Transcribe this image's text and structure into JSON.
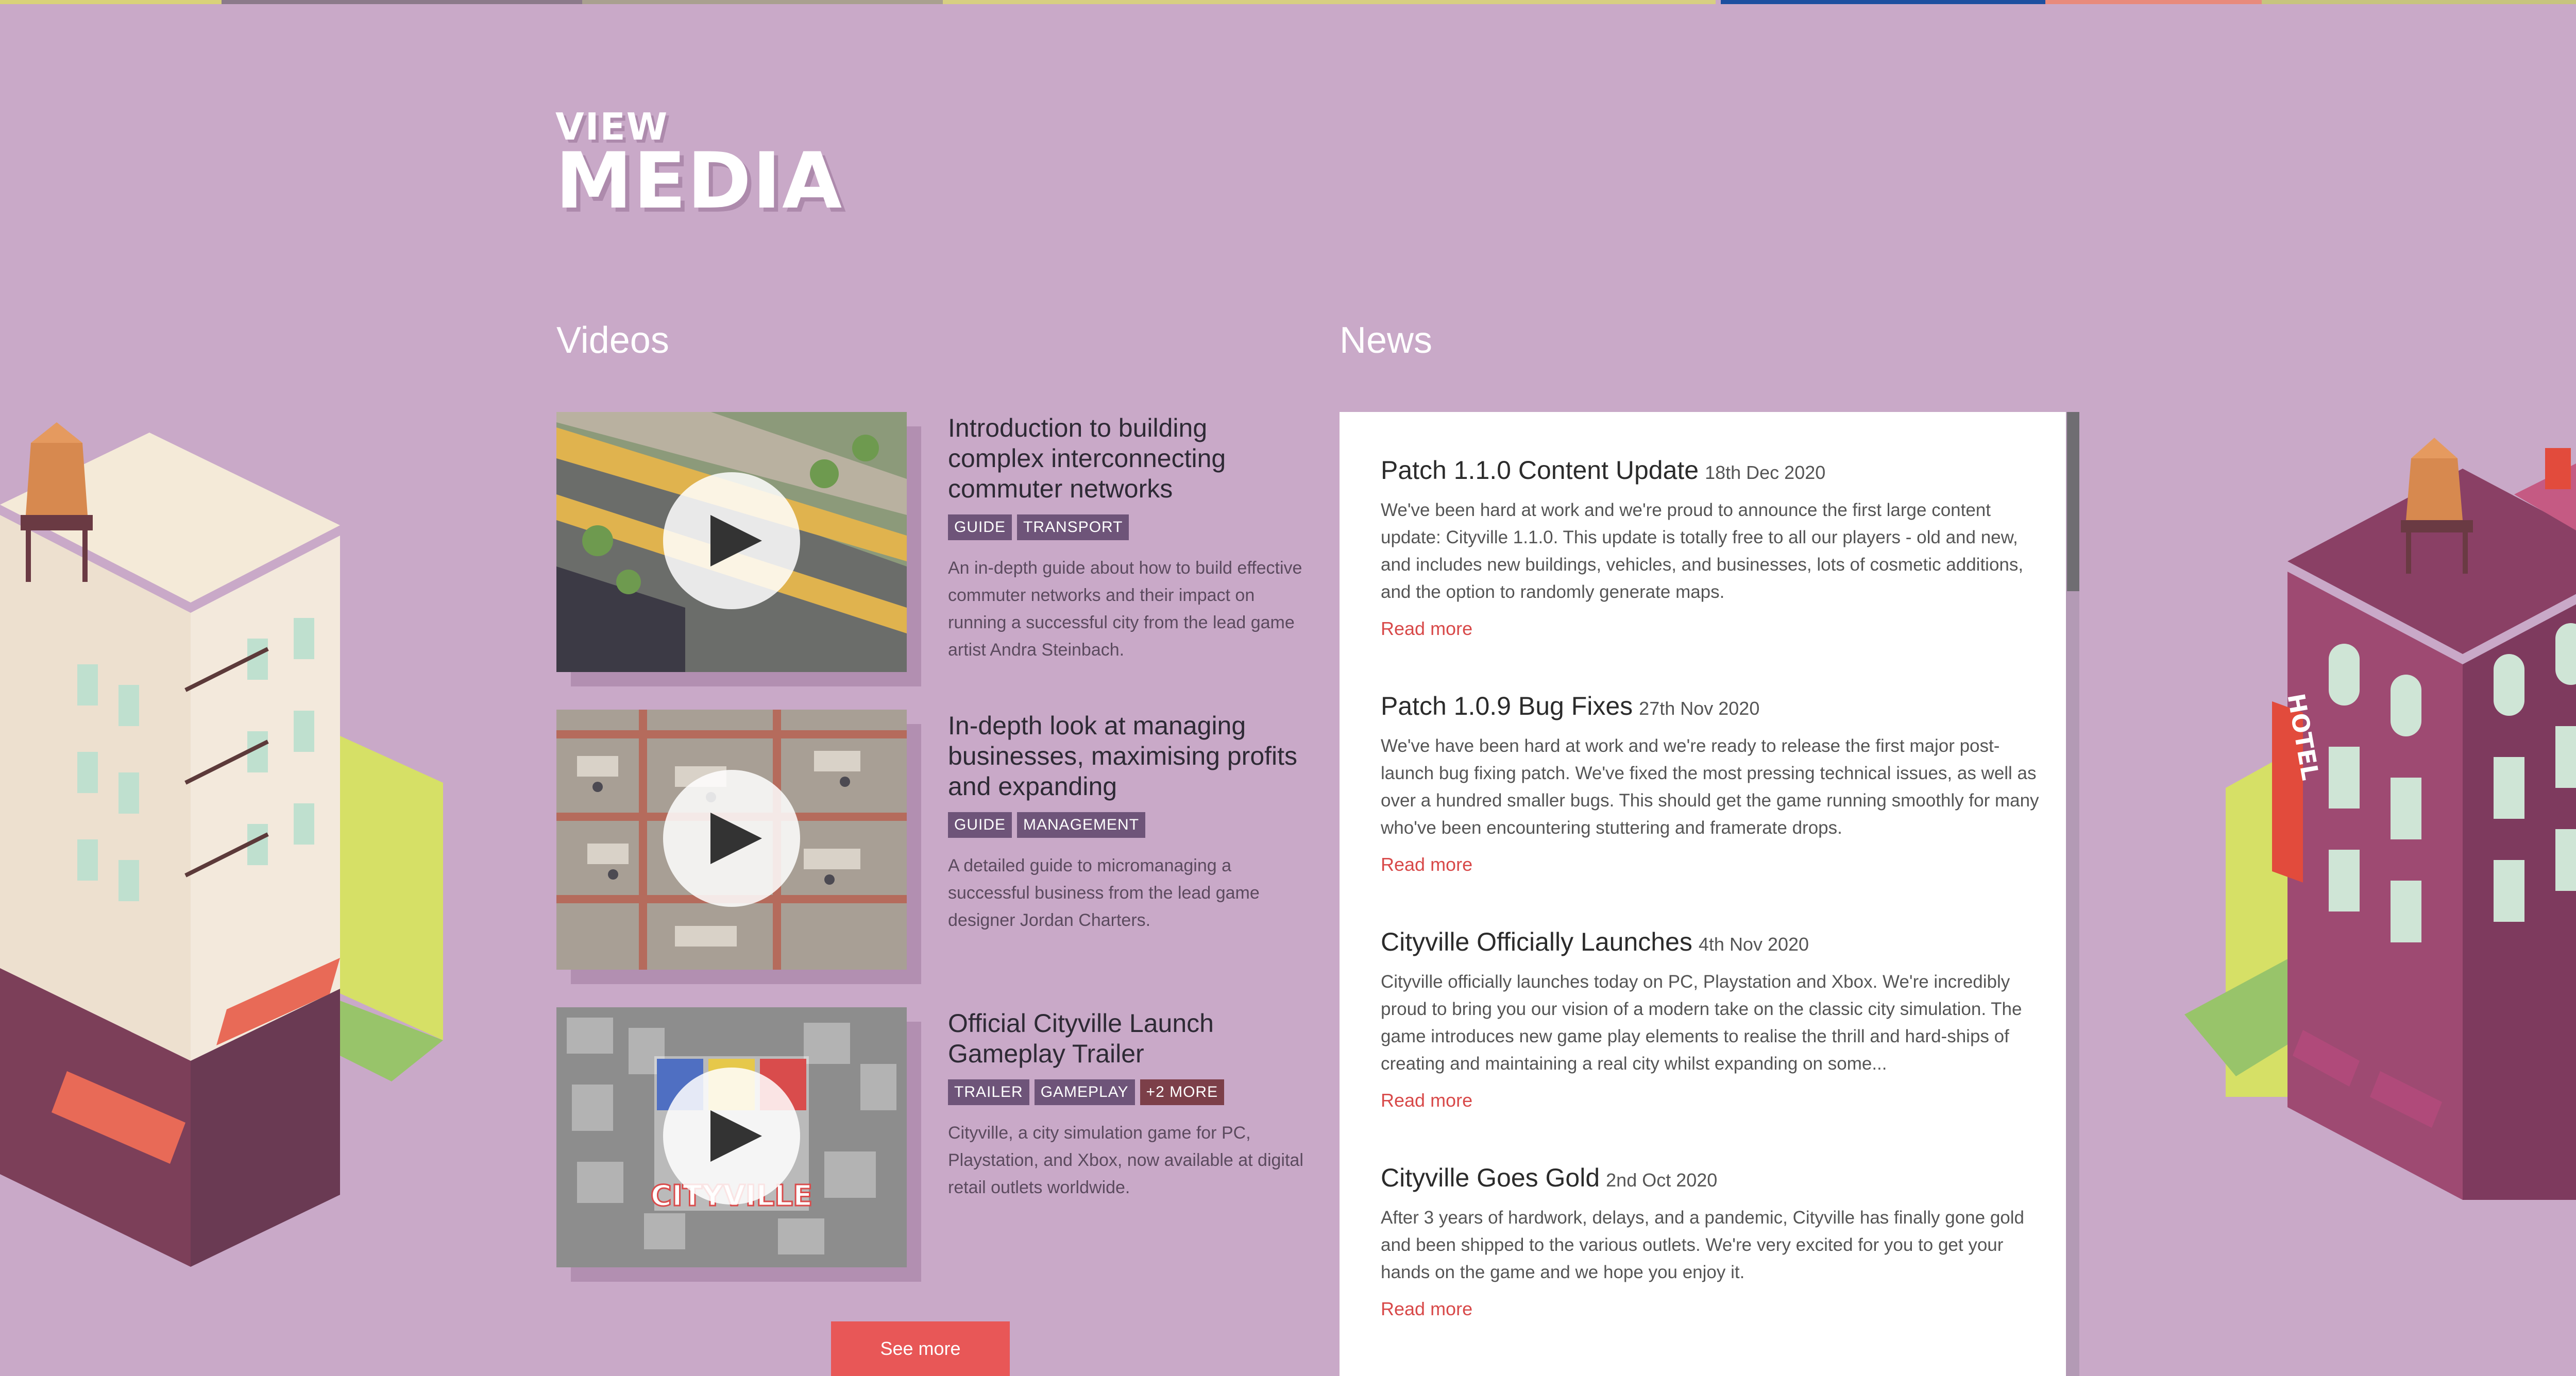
{
  "header": {
    "small": "VIEW",
    "large": "MEDIA"
  },
  "videos": {
    "title": "Videos",
    "items": [
      {
        "title": "Introduction to building complex interconnecting commuter networks",
        "tags": [
          "GUIDE",
          "TRANSPORT"
        ],
        "description": "An in-depth guide about how to build effective commuter networks and their impact on running a successful city from the lead game artist Andra Steinbach."
      },
      {
        "title": "In-depth look at managing businesses, maximising profits and expanding",
        "tags": [
          "GUIDE",
          "MANAGEMENT"
        ],
        "description": "A detailed guide to micromanaging a successful business from the lead game designer Jordan Charters."
      },
      {
        "title": "Official Cityville Launch Gameplay Trailer",
        "tags": [
          "TRAILER",
          "GAMEPLAY"
        ],
        "more_tag": "+2 MORE",
        "description": "Cityville, a city simulation game for PC, Playstation, and Xbox, now available at digital retail outlets worldwide.",
        "thumb_logo": "CITYVILLE"
      }
    ],
    "see_more_label": "See more"
  },
  "news": {
    "title": "News",
    "read_more_label": "Read more",
    "items": [
      {
        "headline": "Patch 1.1.0 Content Update",
        "date": "18th Dec 2020",
        "body": "We've been hard at work and we're proud to announce the first large content update: Cityville 1.1.0. This update is totally free to all our players - old and new, and includes new buildings, vehicles, and businesses, lots of cosmetic additions, and the option to randomly generate maps."
      },
      {
        "headline": "Patch 1.0.9 Bug Fixes",
        "date": "27th Nov 2020",
        "body": "We've have been hard at work and we're ready to release the first major post-launch bug fixing patch. We've fixed the most pressing technical issues, as well as over a hundred smaller bugs. This should get the game running smoothly for many who've been encountering stuttering and framerate drops."
      },
      {
        "headline": "Cityville Officially Launches",
        "date": "4th Nov 2020",
        "body": "Cityville officially launches today on PC, Playstation and Xbox. We're incredibly proud to bring you our vision of a modern take on the classic city simulation. The game introduces new game play elements to realise the thrill and hard-ships of creating and maintaining a real city whilst expanding on some..."
      },
      {
        "headline": "Cityville Goes Gold",
        "date": "2nd Oct 2020",
        "body": "After 3 years of hardwork, delays, and a pandemic, Cityville has finally gone gold and been shipped to the various outlets. We're very excited for you to get your hands on the game and we hope you enjoy it."
      }
    ]
  },
  "decor": {
    "hotel_sign": "HOTEL"
  },
  "colors": {
    "background": "#c9a9c8",
    "accent": "#e85757",
    "tag": "#6e5479",
    "tag_more": "#7c3f49"
  }
}
